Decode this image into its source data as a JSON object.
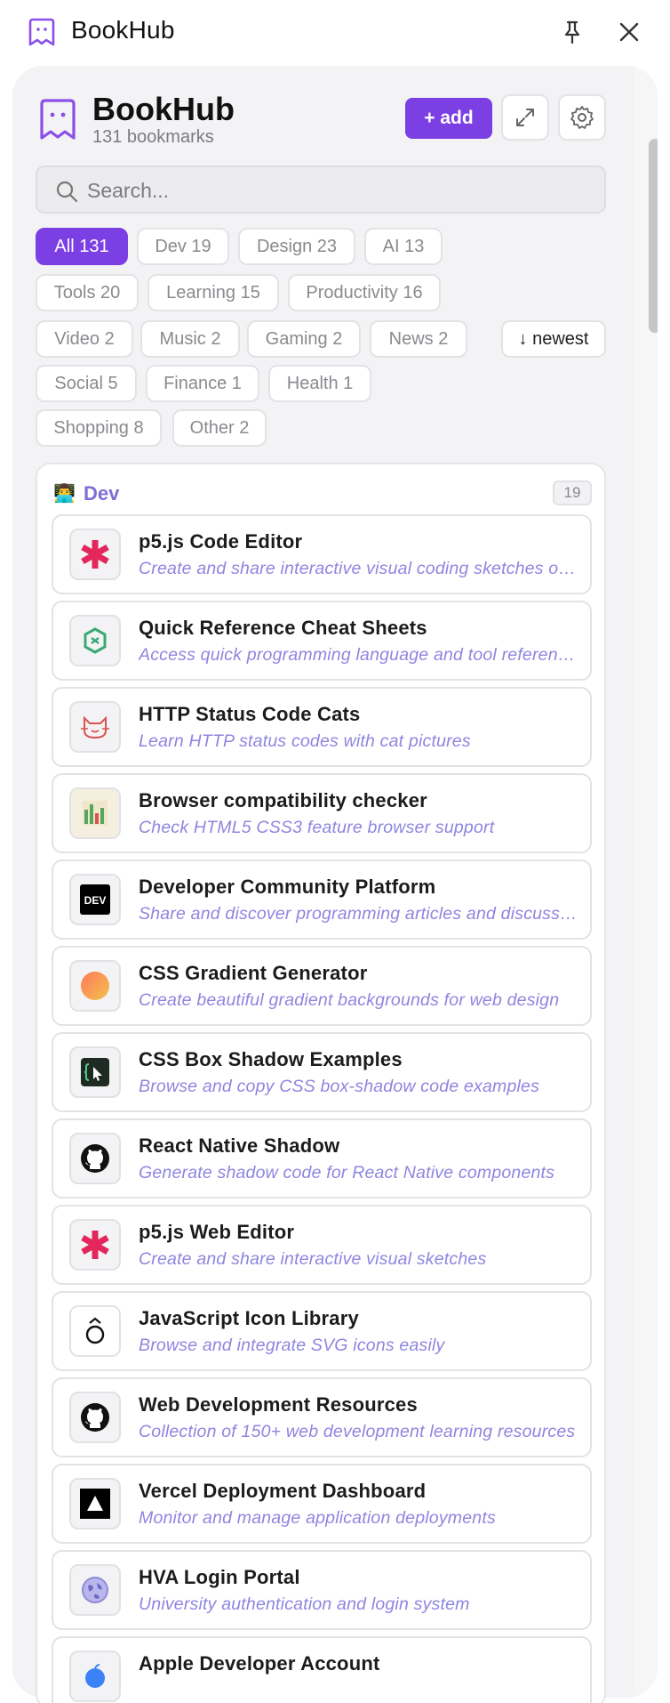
{
  "titlebar": {
    "title": "BookHub"
  },
  "header": {
    "app_name": "BookHub",
    "count_label": "131 bookmarks",
    "add_label": "+ add"
  },
  "search": {
    "placeholder": "Search...",
    "value": ""
  },
  "sort": {
    "label": "↓ newest"
  },
  "categories": [
    {
      "label": "All 131",
      "active": true
    },
    {
      "label": "Dev 19"
    },
    {
      "label": "Design 23"
    },
    {
      "label": "AI 13"
    },
    {
      "label": "Tools 20"
    },
    {
      "label": "Learning 15"
    },
    {
      "label": "Productivity 16"
    },
    {
      "label": "Video 2"
    },
    {
      "label": "Music 2"
    },
    {
      "label": "Gaming 2"
    },
    {
      "label": "News 2"
    },
    {
      "label": "Social 5"
    },
    {
      "label": "Finance 1"
    },
    {
      "label": "Health 1"
    },
    {
      "label": "Shopping 8"
    },
    {
      "label": "Other 2"
    }
  ],
  "section": {
    "emoji": "👨‍💻",
    "title": "Dev",
    "count": "19",
    "items": [
      {
        "name": "p5.js Code Editor",
        "desc": "Create and share interactive visual coding sketches online",
        "icon": "p5js-asterisk-icon"
      },
      {
        "name": "Quick Reference Cheat Sheets",
        "desc": "Access quick programming language and tool references",
        "icon": "quickref-icon"
      },
      {
        "name": "HTTP Status Code Cats",
        "desc": "Learn HTTP status codes with cat pictures",
        "icon": "cat-icon"
      },
      {
        "name": "Browser compatibility checker",
        "desc": "Check HTML5 CSS3 feature browser support",
        "icon": "caniuse-chart-icon"
      },
      {
        "name": "Developer Community Platform",
        "desc": "Share and discover programming articles and discussions",
        "icon": "dev-logo-icon"
      },
      {
        "name": "CSS Gradient Generator",
        "desc": "Create beautiful gradient backgrounds for web design",
        "icon": "gradient-circle-icon"
      },
      {
        "name": "CSS Box Shadow Examples",
        "desc": "Browse and copy CSS box-shadow code examples",
        "icon": "cursor-brackets-icon"
      },
      {
        "name": "React Native Shadow",
        "desc": "Generate shadow code for React Native components",
        "icon": "github-icon"
      },
      {
        "name": "p5.js Web Editor",
        "desc": "Create and share interactive visual sketches",
        "icon": "p5js-asterisk-icon"
      },
      {
        "name": "JavaScript Icon Library",
        "desc": "Browse and integrate SVG icons easily",
        "icon": "o-circumflex-icon"
      },
      {
        "name": "Web Development Resources",
        "desc": "Collection of 150+ web development learning resources",
        "icon": "github-icon"
      },
      {
        "name": "Vercel Deployment Dashboard",
        "desc": "Monitor and manage application deployments",
        "icon": "vercel-triangle-icon"
      },
      {
        "name": "HVA Login Portal",
        "desc": "University authentication and login system",
        "icon": "globe-icon"
      },
      {
        "name": "Apple Developer Account",
        "desc": "",
        "icon": "apple-icon"
      }
    ]
  },
  "colors": {
    "accent": "#7b3fe4",
    "description_text": "#8f85e0",
    "section_title": "#7d6fd6"
  }
}
